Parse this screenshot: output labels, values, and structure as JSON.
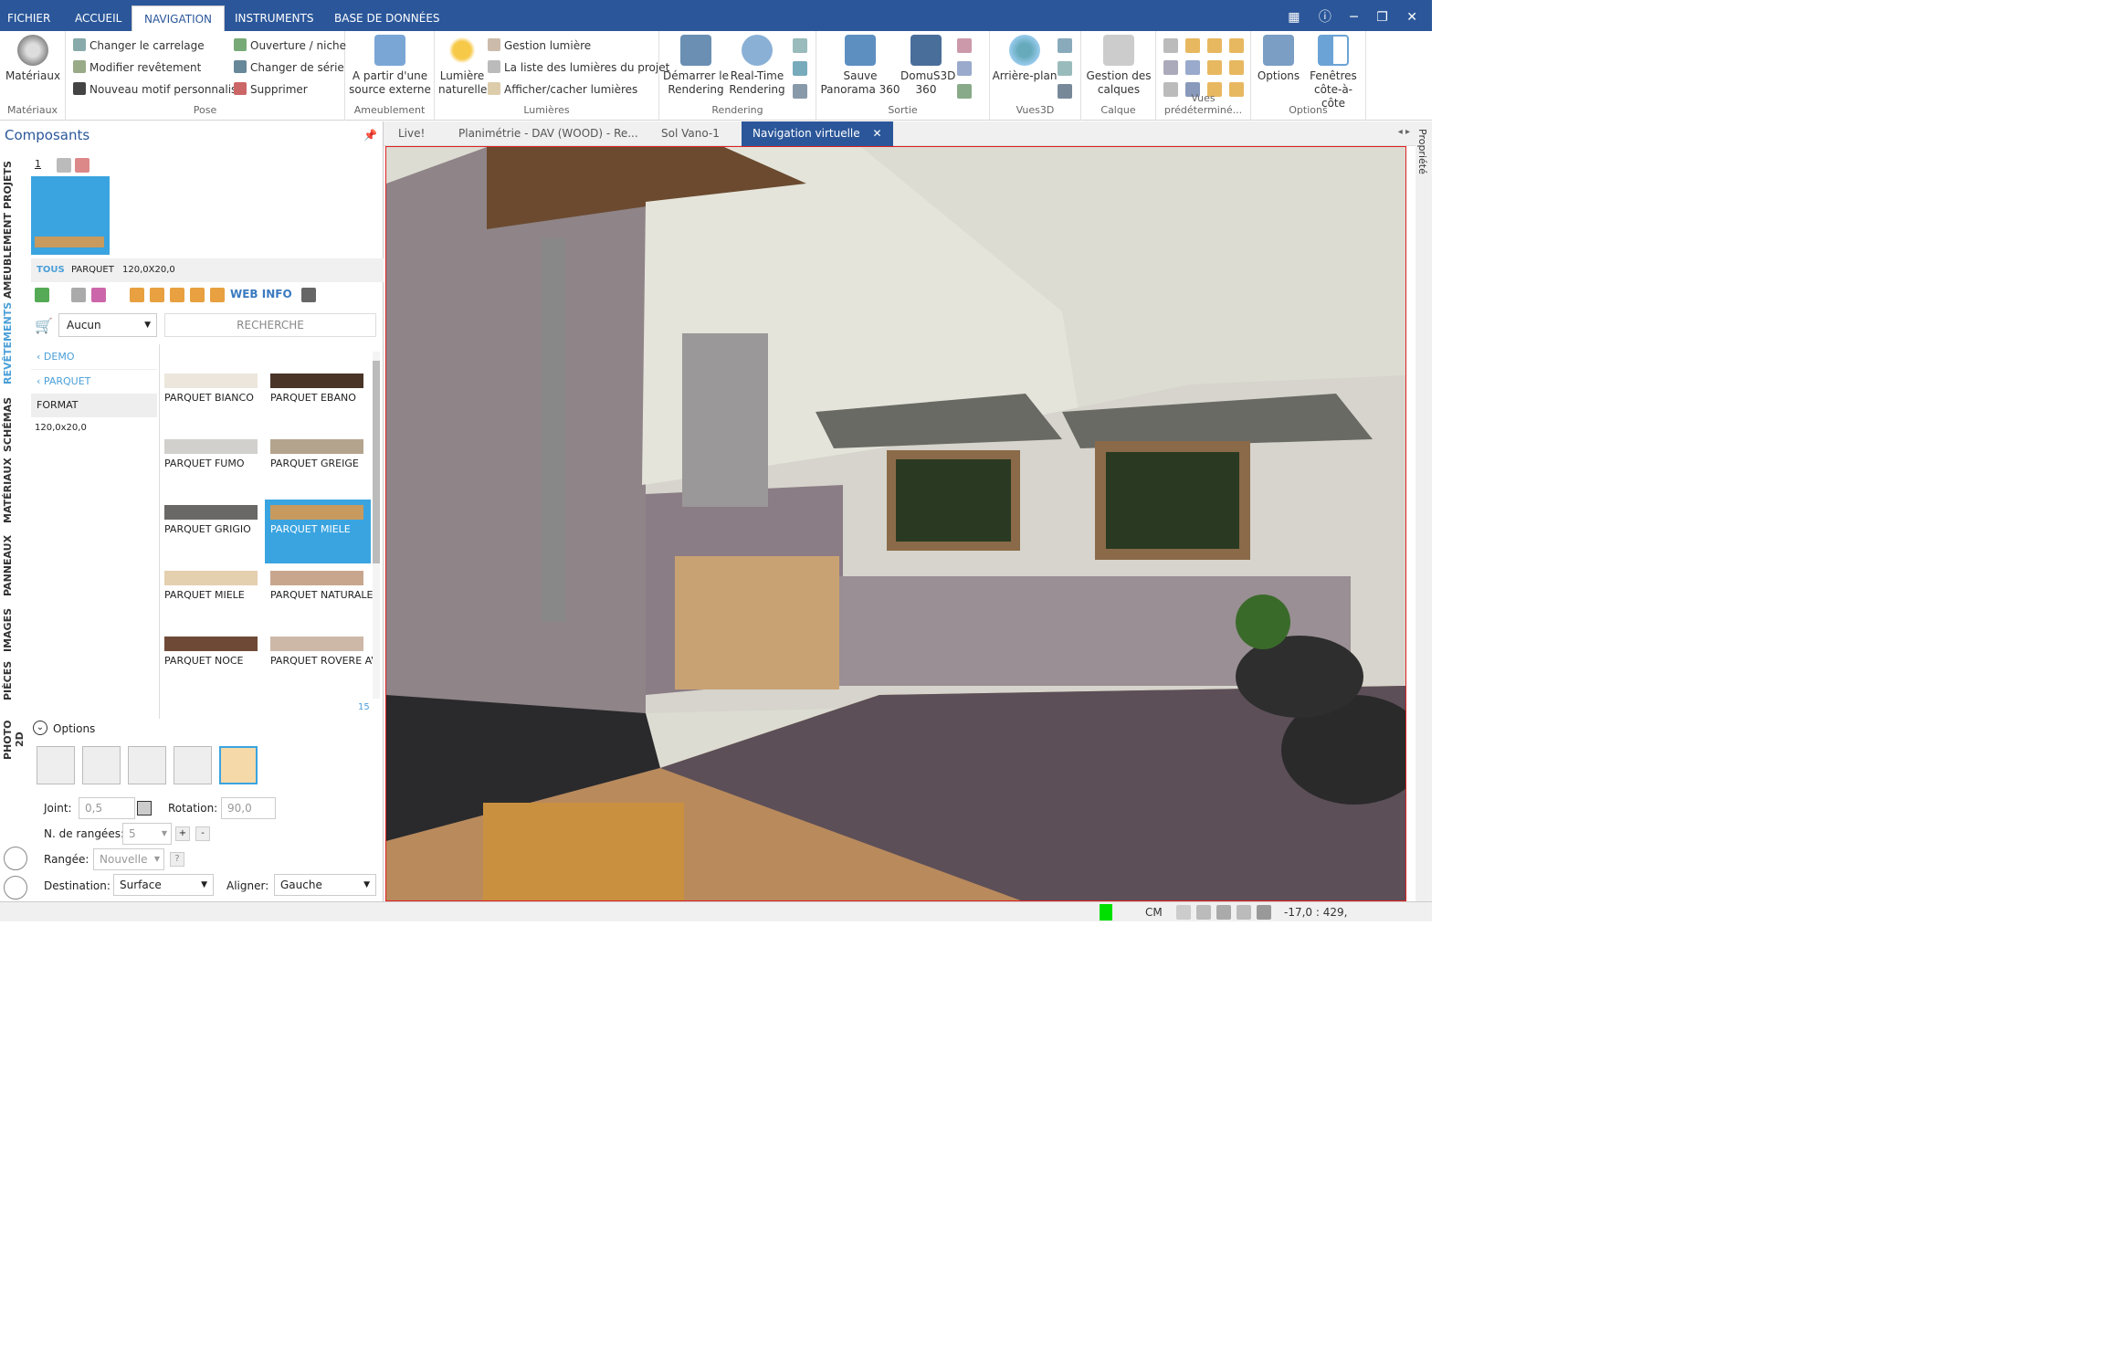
{
  "ribbon": {
    "tabs": [
      "FICHIER",
      "ACCUEIL",
      "NAVIGATION",
      "INSTRUMENTS",
      "BASE DE DONNÉES"
    ],
    "active_tab": "NAVIGATION"
  },
  "groups": {
    "materiaux": {
      "label": "Matériaux",
      "button": "Matériaux"
    },
    "pose": {
      "label": "Pose",
      "items": [
        "Changer le carrelage",
        "Modifier revêtement",
        "Nouveau motif personnalisé",
        "Ouverture / niche",
        "Changer de série",
        "Supprimer"
      ]
    },
    "ameublement": {
      "label": "Ameublement",
      "button_line1": "A partir d'une",
      "button_line2": "source externe"
    },
    "lumieres": {
      "label": "Lumières",
      "big_line1": "Lumière",
      "big_line2": "naturelle",
      "items": [
        "Gestion lumière",
        "La liste des lumières du projet",
        "Afficher/cacher lumières"
      ]
    },
    "rendering": {
      "label": "Rendering",
      "b1_line1": "Démarrer le",
      "b1_line2": "Rendering",
      "b2_line1": "Real-Time",
      "b2_line2": "Rendering"
    },
    "sortie": {
      "label": "Sortie",
      "b1_line1": "Sauve",
      "b1_line2": "Panorama 360",
      "b2_line1": "DomuS3D",
      "b2_line2": "360"
    },
    "vues3d": {
      "label": "Vues3D",
      "button": "Arrière-plan"
    },
    "calque": {
      "label": "Calque",
      "line1": "Gestion des",
      "line2": "calques"
    },
    "vuespred": {
      "label": "Vues prédéterminé..."
    },
    "options": {
      "label": "Options",
      "b1": "Options",
      "b2_line1": "Fenêtres",
      "b2_line2": "côte-à-côte"
    }
  },
  "panel": {
    "title": "Composants",
    "thumb_index": "1",
    "filters": {
      "all": "TOUS",
      "cat": "PARQUET",
      "size": "120,0X20,0"
    },
    "webinfo": "WEB INFO",
    "dropdown": "Aucun",
    "search": "RECHERCHE",
    "tree": {
      "demo": "DEMO",
      "parquet": "PARQUET",
      "format_header": "FORMAT",
      "format_value": "120,0x20,0"
    },
    "tiles": [
      {
        "label": "PARQUET BIANCO",
        "color": "#ece6dc"
      },
      {
        "label": "PARQUET EBANO",
        "color": "#4a3428"
      },
      {
        "label": "PARQUET FUMO",
        "color": "#d2d0cc"
      },
      {
        "label": "PARQUET GREIGE",
        "color": "#b4a48e"
      },
      {
        "label": "PARQUET GRIGIO",
        "color": "#6a6866"
      },
      {
        "label": "PARQUET MIELE",
        "color": "#c89a5e"
      },
      {
        "label": "PARQUET MIELE",
        "color": "#e4cfae"
      },
      {
        "label": "PARQUET NATURALE",
        "color": "#c8a68e"
      },
      {
        "label": "PARQUET NOCE",
        "color": "#6e4a36"
      },
      {
        "label": "PARQUET ROVERE AV",
        "color": "#cdb8a8"
      }
    ],
    "count": "15",
    "options_label": "Options",
    "form": {
      "joint_label": "Joint:",
      "joint_value": "0,5",
      "rotation_label": "Rotation:",
      "rotation_value": "90,0",
      "rangees_label": "N. de rangées:",
      "rangees_value": "5",
      "rangee_label": "Rangée:",
      "rangee_value": "Nouvelle",
      "destination_label": "Destination:",
      "destination_value": "Surface",
      "aligner_label": "Aligner:",
      "aligner_value": "Gauche",
      "plus": "+",
      "minus": "-",
      "help": "?"
    }
  },
  "vtabs": [
    "PROJETS",
    "AMEUBLEMENT",
    "REVÊTEMENTS",
    "SCHÉMAS",
    "MATÉRIAUX",
    "PANNEAUX",
    "IMAGES",
    "PIÈCES",
    "PHOTO 2D"
  ],
  "doc_tabs": [
    "Live!",
    "Planimétrie - DAV (WOOD) - Re...",
    "Sol Vano-1",
    "Navigation virtuelle"
  ],
  "doc_close": "✕",
  "right_tab": "Propriété",
  "status": {
    "unit": "CM",
    "coords": "-17,0 : 429,"
  }
}
